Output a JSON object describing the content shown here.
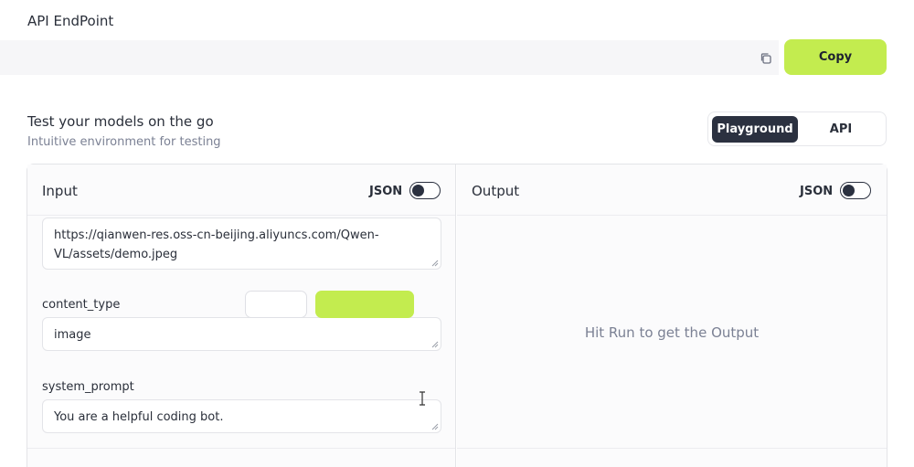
{
  "endpoint": {
    "title": "API EndPoint",
    "url_value": "",
    "copy_label": "Copy",
    "copy_icon": "copy-icon"
  },
  "test": {
    "title": "Test your models on the go",
    "subtitle": "Intuitive environment for testing"
  },
  "mode_toggle": {
    "options": [
      "Playground",
      "API"
    ],
    "selected": "Playground"
  },
  "input_panel": {
    "title": "Input",
    "json_label": "JSON",
    "json_enabled": false,
    "fields": [
      {
        "label": "",
        "value": "https://qianwen-res.oss-cn-beijing.aliyuncs.com/Qwen-VL/assets/demo.jpeg"
      },
      {
        "label": "content_type",
        "value": "image"
      },
      {
        "label": "system_prompt",
        "value": "You are a helpful coding bot."
      }
    ]
  },
  "output_panel": {
    "title": "Output",
    "json_label": "JSON",
    "json_enabled": false,
    "placeholder": "Hit Run to get the Output"
  },
  "colors": {
    "accent": "#c3ec4f",
    "dark": "#2b3140",
    "muted_text": "#7b8194",
    "border": "#e3e4e8"
  }
}
